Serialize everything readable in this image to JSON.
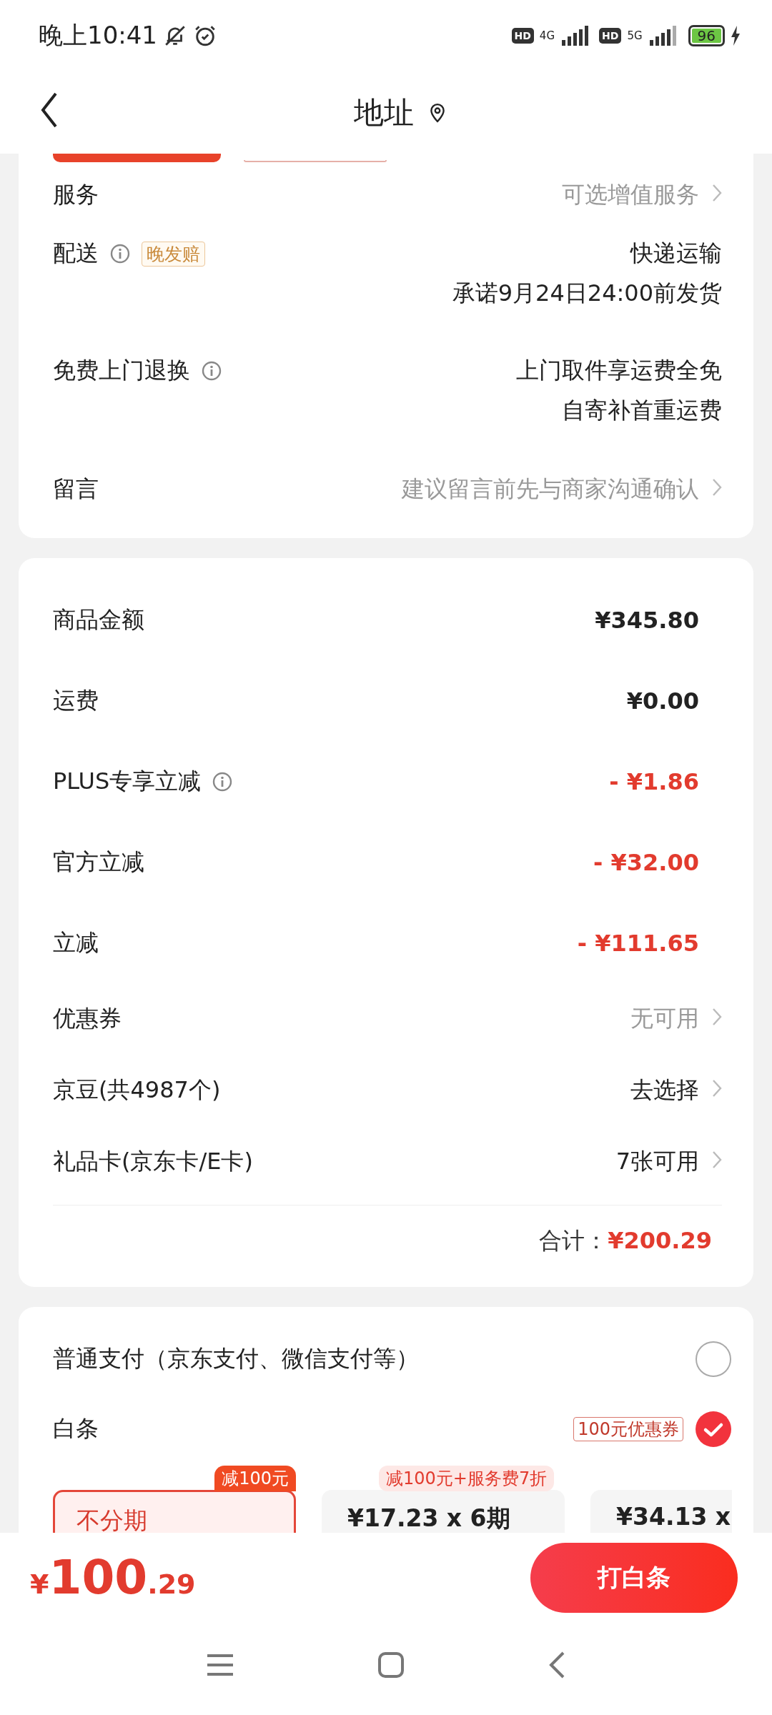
{
  "status_bar": {
    "time": "晚上10:41",
    "network_1": "4G",
    "network_2": "5G",
    "hd_1": "HD",
    "hd_2": "HD",
    "battery": "96"
  },
  "header": {
    "title": "地址"
  },
  "order_info": [
    {
      "label": "服务",
      "info": false,
      "values": [
        "可选增值服务"
      ],
      "muted": true,
      "link": true
    },
    {
      "label": "配送",
      "info": true,
      "tag": "晚发赔",
      "values": [
        "快递运输",
        "承诺9月24日24:00前发货"
      ],
      "muted": false,
      "link": false
    },
    {
      "label": "免费上门退换",
      "info": true,
      "values": [
        "上门取件享运费全免",
        "自寄补首重运费"
      ],
      "muted": false,
      "link": false
    },
    {
      "label": "留言",
      "info": false,
      "values": [
        "建议留言前先与商家沟通确认"
      ],
      "muted": true,
      "link": true
    }
  ],
  "price_rows": [
    {
      "label": "商品金额",
      "info": false,
      "value": "¥345.80",
      "kind": "amount",
      "link": false
    },
    {
      "label": "运费",
      "info": false,
      "value": "¥0.00",
      "kind": "amount",
      "link": false
    },
    {
      "label": "PLUS专享立减",
      "info": true,
      "value": "- ¥1.86",
      "kind": "discount",
      "link": false
    },
    {
      "label": "官方立减",
      "info": false,
      "value": "- ¥32.00",
      "kind": "discount",
      "link": false
    },
    {
      "label": "立减",
      "info": false,
      "value": "- ¥111.65",
      "kind": "discount",
      "link": false
    },
    {
      "label": "优惠券",
      "info": false,
      "value": "无可用",
      "kind": "muted",
      "link": true
    },
    {
      "label": "京豆(共4987个)",
      "info": false,
      "value": "去选择",
      "kind": "option",
      "link": true
    },
    {
      "label": "礼品卡(京东卡/E卡)",
      "info": false,
      "value": "7张可用",
      "kind": "option",
      "link": true
    }
  ],
  "total": {
    "label": "合计：",
    "value": "¥200.29"
  },
  "payment_options": [
    {
      "label": "普通支付（京东支付、微信支付等）",
      "selected": false
    },
    {
      "label": "白条",
      "tag": "100元优惠券",
      "selected": true
    }
  ],
  "plans": [
    {
      "badge": "减100元",
      "label": "不分期",
      "selected": true
    },
    {
      "badge": "减100元+服务费7折",
      "label": "¥17.23 x 6期",
      "selected": false
    },
    {
      "label": "¥34.13 x",
      "selected": false
    }
  ],
  "footer": {
    "currency": "¥",
    "amount": "100",
    "decimals": ".29",
    "button": "打白条"
  }
}
